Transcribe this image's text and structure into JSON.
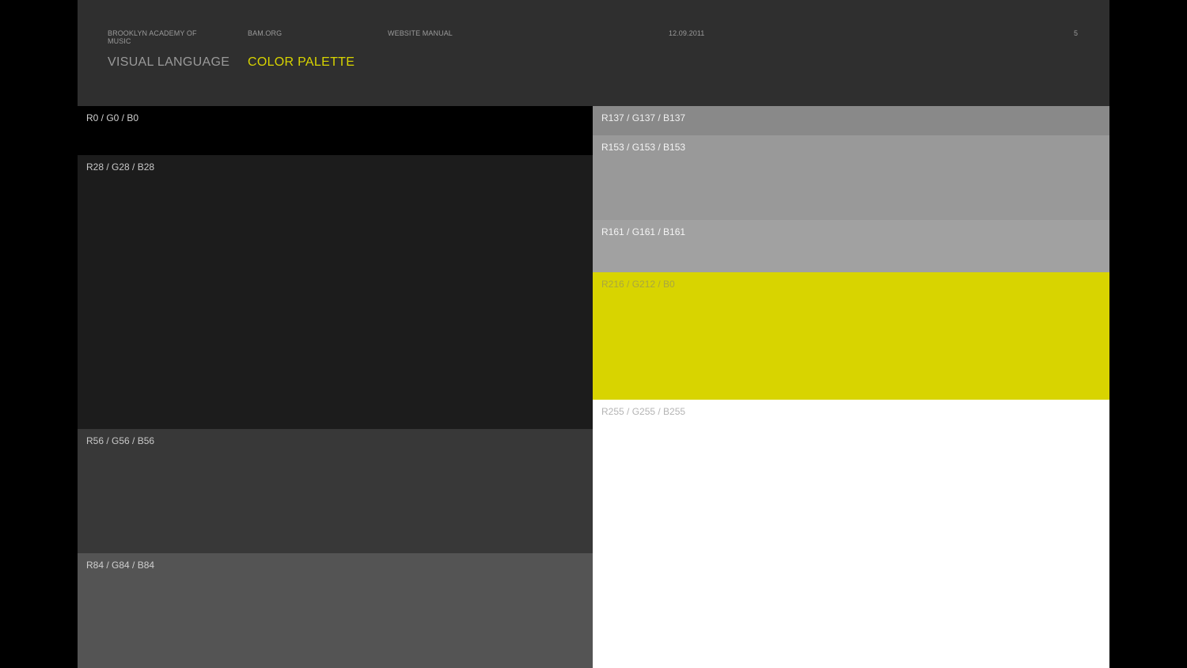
{
  "header": {
    "organization": "BROOKLYN ACADEMY OF MUSIC",
    "site": "BAM.ORG",
    "document": "WEBSITE MANUAL",
    "date": "12.09.2011",
    "page_number": "5",
    "section": "VISUAL LANGUAGE",
    "subsection": "COLOR PALETTE",
    "subsection_color": "#d8d400"
  },
  "swatches": {
    "left": [
      {
        "label": "R0 / G0 / B0",
        "color": "#000000",
        "text_color": "#d0d0d0"
      },
      {
        "label": "R28 / G28 / B28",
        "color": "#1c1c1c",
        "text_color": "#c8c8c8"
      },
      {
        "label": "R56 / G56 / B56",
        "color": "#383838",
        "text_color": "#c8c8c8"
      },
      {
        "label": "R84 / G84 / B84",
        "color": "#545454",
        "text_color": "#cfcfcf"
      }
    ],
    "right": [
      {
        "label": "R137 / G137 / B137",
        "color": "#898989",
        "text_color": "#f0f0f0"
      },
      {
        "label": "R153 / G153 / B153",
        "color": "#999999",
        "text_color": "#f5f5f5"
      },
      {
        "label": "R161 / G161 / B161",
        "color": "#a1a1a1",
        "text_color": "#f5f5f5"
      },
      {
        "label": "R216 / G212 / B0",
        "color": "#d8d400",
        "text_color": "#a8a640"
      },
      {
        "label": "R255 / G255 / B255",
        "color": "#ffffff",
        "text_color": "#b4b4b4"
      }
    ]
  }
}
